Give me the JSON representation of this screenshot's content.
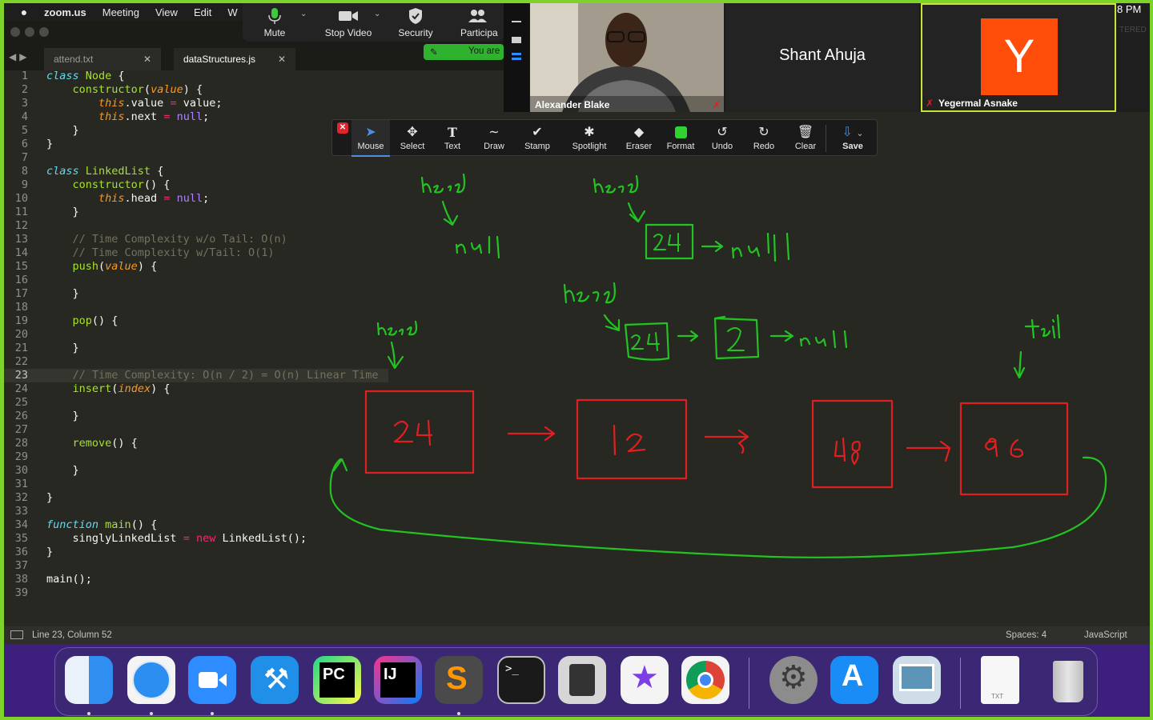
{
  "menubar": {
    "app": "zoom.us",
    "items": [
      "Meeting",
      "View",
      "Edit",
      "W"
    ],
    "clock": "8 PM"
  },
  "tabs": [
    {
      "label": "attend.txt",
      "active": false
    },
    {
      "label": "dataStructures.js",
      "active": true
    }
  ],
  "code_lines": [
    "1",
    "2",
    "3",
    "4",
    "5",
    "6",
    "7",
    "8",
    "9",
    "10",
    "11",
    "12",
    "13",
    "14",
    "15",
    "16",
    "17",
    "18",
    "19",
    "20",
    "21",
    "22",
    "23",
    "24",
    "25",
    "26",
    "27",
    "28",
    "29",
    "30",
    "31",
    "32",
    "33",
    "34",
    "35",
    "36",
    "37",
    "38",
    "39"
  ],
  "current_line": 23,
  "statusbar": {
    "position": "Line 23, Column 52",
    "spaces": "Spaces: 4",
    "language": "JavaScript"
  },
  "zoom_controls": {
    "mute": "Mute",
    "stop_video": "Stop Video",
    "security": "Security",
    "participants": "Participa",
    "you_are": "You are"
  },
  "video": {
    "tile_a_name": "Alexander Blake",
    "tile_b_name": "Shant Ahuja",
    "tile_c_name": "Yegermal Asnake",
    "tile_c_initial": "Y",
    "corner_text": "TERED"
  },
  "annotation_tools": [
    {
      "name": "mouse",
      "label": "Mouse",
      "icon": "cursor-icon"
    },
    {
      "name": "select",
      "label": "Select",
      "icon": "move-icon"
    },
    {
      "name": "text",
      "label": "Text",
      "icon": "text-icon"
    },
    {
      "name": "draw",
      "label": "Draw",
      "icon": "squiggle-icon"
    },
    {
      "name": "stamp",
      "label": "Stamp",
      "icon": "checkmark-icon"
    },
    {
      "name": "spotlight",
      "label": "Spotlight",
      "icon": "wand-icon"
    },
    {
      "name": "eraser",
      "label": "Eraser",
      "icon": "eraser-icon"
    },
    {
      "name": "format",
      "label": "Format",
      "icon": "color-swatch-icon"
    },
    {
      "name": "undo",
      "label": "Undo",
      "icon": "undo-icon"
    },
    {
      "name": "redo",
      "label": "Redo",
      "icon": "redo-icon"
    },
    {
      "name": "clear",
      "label": "Clear",
      "icon": "trash-icon"
    },
    {
      "name": "save",
      "label": "Save",
      "icon": "save-icon"
    }
  ],
  "drawing": {
    "node_values": [
      "24",
      "12",
      "48",
      "96"
    ],
    "small_values": [
      "24",
      "24",
      "2"
    ],
    "ink_colors": {
      "green": "#22c322",
      "red": "#e02020"
    }
  },
  "dock": {
    "apps": [
      "Finder",
      "Safari",
      "Zoom",
      "Xcode",
      "PyCharm",
      "IntelliJ IDEA",
      "Sublime Text",
      "Terminal",
      "Calculator",
      "iMovie",
      "Chrome",
      "System Preferences",
      "App Store",
      "Preview",
      "TXT",
      "Trash"
    ],
    "txt_label": "TXT"
  },
  "colors": {
    "frame_green": "#7fd22a",
    "editor_bg": "#272822",
    "zoom_blue": "#2d8cff",
    "avatar_orange": "#ff4d0a"
  }
}
